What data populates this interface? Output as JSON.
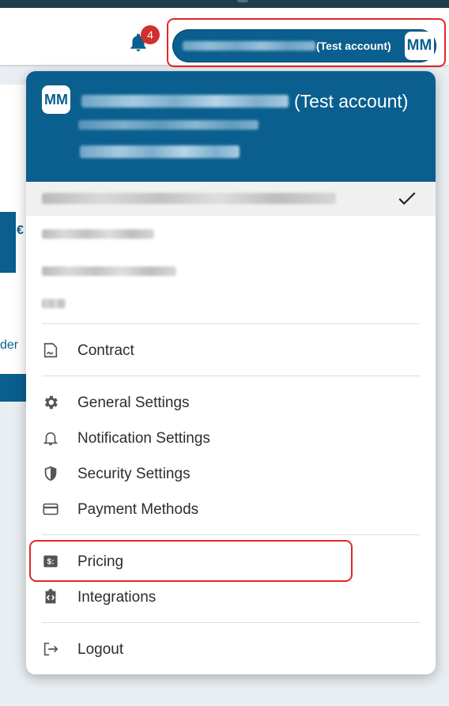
{
  "topbar": {
    "notification_count": "4",
    "account_button": {
      "tag": "(Test account)",
      "avatar_initials": "MM"
    }
  },
  "menu": {
    "header": {
      "avatar_initials": "MM",
      "tag": "(Test account)"
    },
    "contract_label": "Contract",
    "settings": [
      {
        "label": "General Settings",
        "icon": "gear-icon"
      },
      {
        "label": "Notification Settings",
        "icon": "bell-icon"
      },
      {
        "label": "Security Settings",
        "icon": "shield-icon"
      },
      {
        "label": "Payment Methods",
        "icon": "credit-card-icon"
      }
    ],
    "pricing_label": "Pricing",
    "integrations_label": "Integrations",
    "logout_label": "Logout"
  },
  "background": {
    "partial_text": "der",
    "partial_symbol": "€"
  },
  "colors": {
    "primary": "#0a5f8e",
    "badge": "#d32f2f",
    "highlight_outline": "#e02828",
    "page_background": "#e9eef2"
  }
}
